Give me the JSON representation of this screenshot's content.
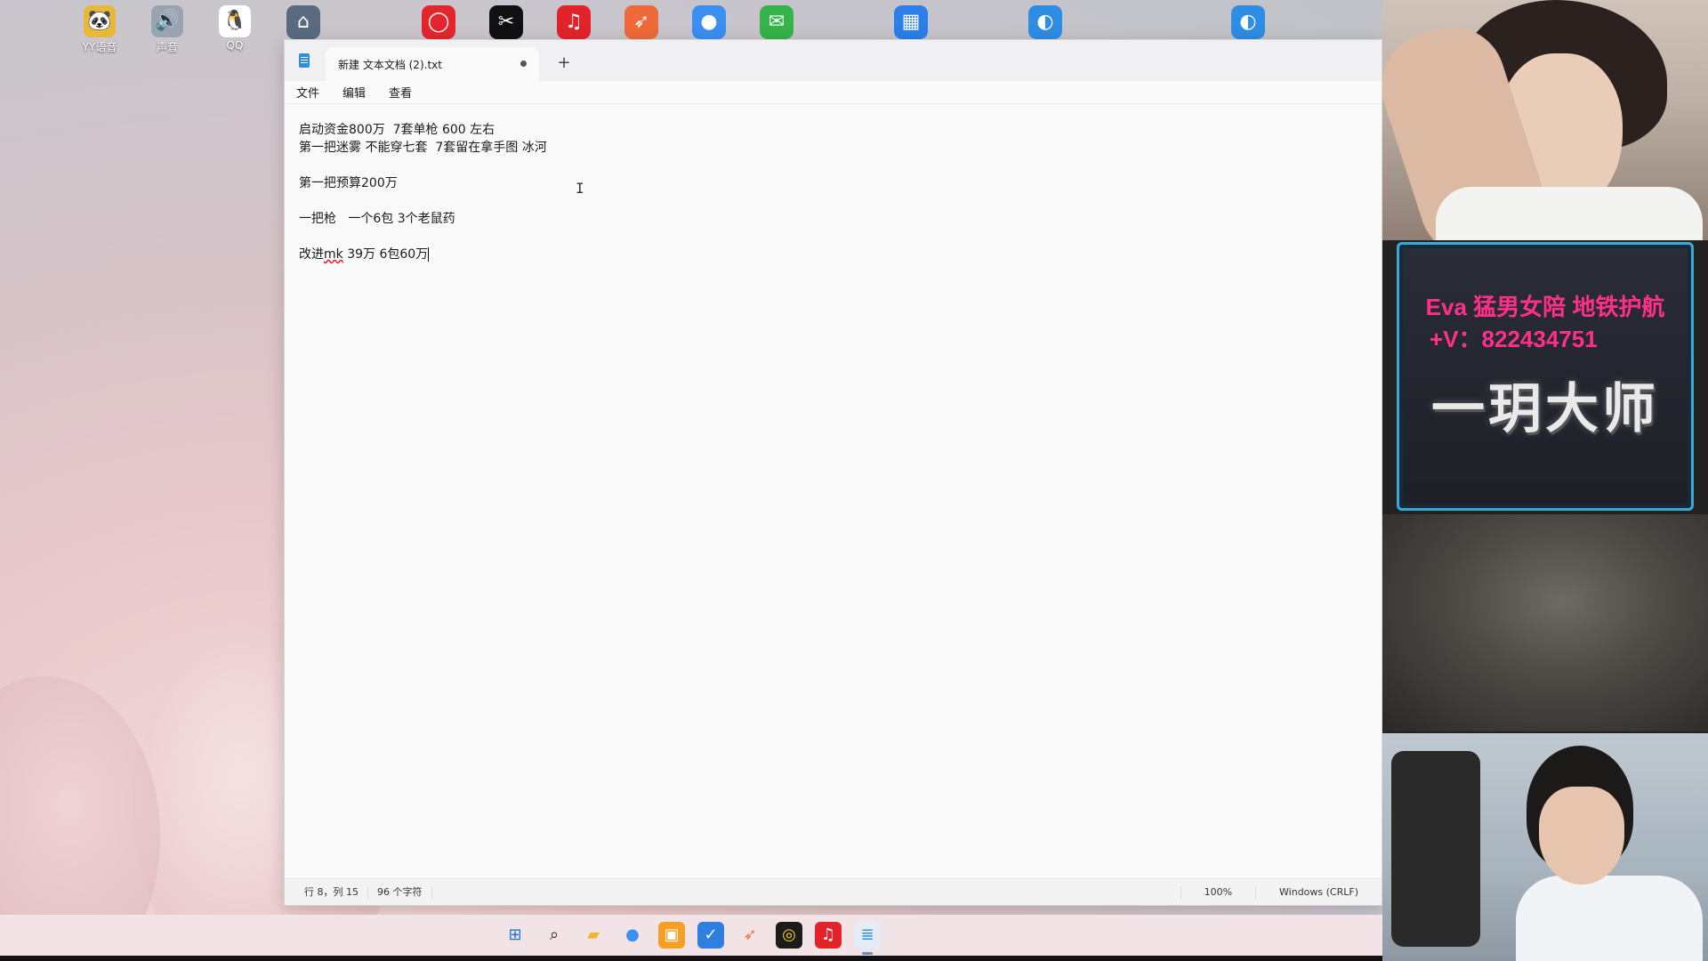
{
  "desktop": {
    "icons": [
      {
        "name": "yy-voice-icon",
        "label": "YY语音",
        "glyph": "🐼",
        "color": "#e8b83a"
      },
      {
        "name": "sound-icon",
        "label": "声音",
        "glyph": "🔊",
        "color": "#9aa4b0"
      },
      {
        "name": "qq-icon",
        "label": "QQ",
        "glyph": "🐧",
        "color": "#ffffff"
      }
    ],
    "top_icons": [
      {
        "name": "remote-desktop-icon",
        "glyph": "⌂",
        "color": "#5a6b80"
      },
      {
        "name": "red-app-icon",
        "glyph": "◯",
        "color": "#e3262e"
      },
      {
        "name": "capcut-icon",
        "glyph": "✂",
        "color": "#111111"
      },
      {
        "name": "netease-music-icon",
        "glyph": "♫",
        "color": "#e2232a"
      },
      {
        "name": "game-launcher-icon",
        "glyph": "➶",
        "color": "#ef6a3a"
      },
      {
        "name": "chrome-icon",
        "glyph": "●",
        "color": "#3a8ff0"
      },
      {
        "name": "wechat-icon",
        "glyph": "✉",
        "color": "#36b34a"
      },
      {
        "name": "blue-grid-app-icon",
        "glyph": "▦",
        "color": "#2b7fe8"
      },
      {
        "name": "edge-browser-icon",
        "glyph": "◐",
        "color": "#2f8de4"
      },
      {
        "name": "edge-browser-2-icon",
        "glyph": "◐",
        "color": "#2f8de4"
      }
    ]
  },
  "notepad": {
    "tab_title": "新建 文本文档 (2).txt",
    "new_tab": "+",
    "menu": [
      "文件",
      "编辑",
      "查看"
    ],
    "lines": [
      "启动资金800万  7套单枪 600 左右",
      "第一把迷雾 不能穿七套  7套留在拿手图 冰河",
      "",
      "第一把预算200万",
      "",
      "一把枪   一个6包 3个老鼠药",
      ""
    ],
    "last_line": {
      "prefix": "改进",
      "misspelled": "mk",
      "rest": " 39万 6包60万"
    },
    "cursor_glyph": "I",
    "status": {
      "position": "行 8，列 15",
      "chars": "96 个字符",
      "zoom": "100%",
      "encoding": "Windows (CRLF)"
    }
  },
  "taskbar": {
    "icons": [
      {
        "name": "start-icon",
        "glyph": "⊞",
        "color": "#1a73d8",
        "active": false
      },
      {
        "name": "search-icon",
        "glyph": "⌕",
        "color": "#222222",
        "active": false
      },
      {
        "name": "file-explorer-icon",
        "glyph": "▰",
        "color": "#f2b530",
        "active": false
      },
      {
        "name": "chrome-icon",
        "glyph": "●",
        "color": "#3a8ff0",
        "active": false
      },
      {
        "name": "orange-app-icon",
        "glyph": "▣",
        "color": "#f3a024",
        "active": false
      },
      {
        "name": "blue-app-icon",
        "glyph": "✓",
        "color": "#2f7fe0",
        "active": false
      },
      {
        "name": "game-launcher-icon",
        "glyph": "➶",
        "color": "#ef6a3a",
        "active": false
      },
      {
        "name": "recorder-icon",
        "glyph": "◎",
        "color": "#1b1b1b",
        "active": false
      },
      {
        "name": "netease-music-icon",
        "glyph": "♫",
        "color": "#e2232a",
        "active": false
      },
      {
        "name": "notepad-icon",
        "glyph": "≣",
        "color": "#2f8fd6",
        "active": true
      }
    ]
  },
  "overlay": {
    "ad_line1": "Eva 猛男女陪 地铁护航",
    "ad_line2": "+V：822434751",
    "brand": "一玥大师"
  }
}
